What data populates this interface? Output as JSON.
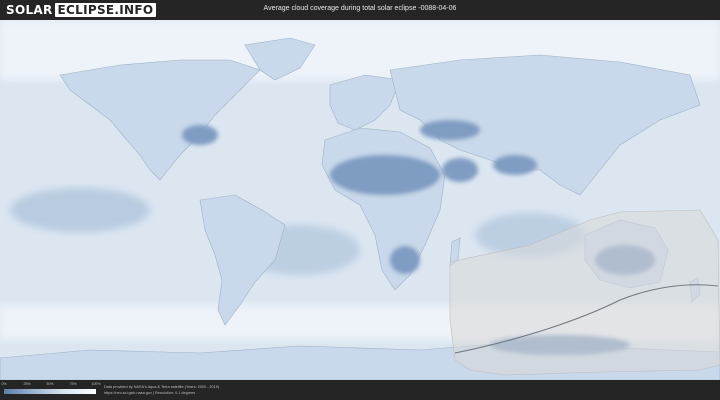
{
  "header": {
    "logo_part1": "SOLAR",
    "logo_part2": "ECLIPSE.INFO",
    "title": "Average cloud coverage during total solar eclipse -0088-04-06"
  },
  "legend": {
    "ticks": [
      "0%",
      "25%",
      "50%",
      "75%",
      "100%"
    ]
  },
  "footer": {
    "credit_line1": "Data provided by NASA's Aqua & Terra satellite (Years: 2000 - 2019)",
    "credit_line2": "https://neo.sci.gsfc.nasa.gov | Resolution: 0.1 degrees"
  },
  "colors": {
    "background": "#2b2b2b",
    "bar": "#252525",
    "ocean_cloudy": "#dbe6f1",
    "clear_sky": "#5b7fab",
    "eclipse_zone": "#d9d9d9",
    "path_line": "#707880"
  },
  "icons": [
    "logo"
  ]
}
